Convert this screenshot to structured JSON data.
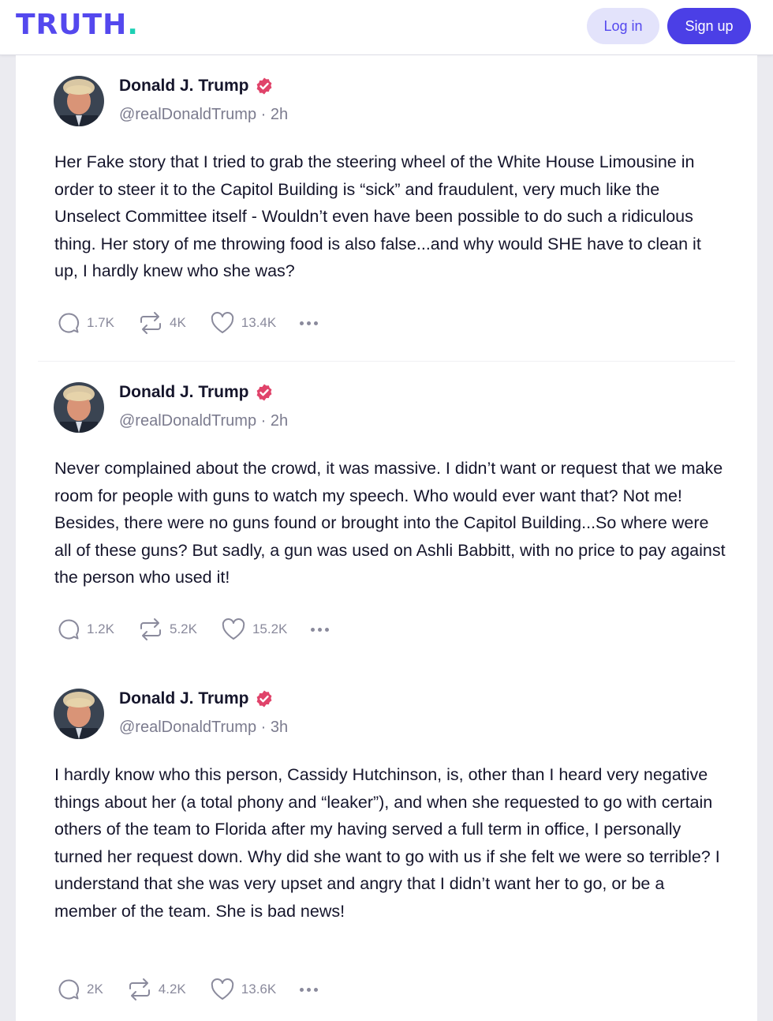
{
  "header": {
    "logo_text": "TRUTH",
    "logo_dot": ".",
    "login_label": "Log in",
    "signup_label": "Sign up"
  },
  "colors": {
    "brand": "#5448ee",
    "brand_accent": "#1dd0b4",
    "verified_badge": "#e0436a",
    "text_muted": "#7b7b8e"
  },
  "posts": [
    {
      "author": "Donald J. Trump",
      "handle": "@realDonaldTrump",
      "time": "2h",
      "text": "Her Fake story that I tried to  grab the steering wheel of the White House Limousine in order to steer it to the Capitol Building is “sick” and fraudulent, very much like the Unselect Committee itself - Wouldn’t even have been possible to do such a ridiculous thing. Her story of me throwing food is also false...and why would SHE have to clean it up, I hardly knew who she was?",
      "replies": "1.7K",
      "retruths": "4K",
      "likes": "13.4K"
    },
    {
      "author": "Donald J. Trump",
      "handle": "@realDonaldTrump",
      "time": "2h",
      "text": "Never complained about the crowd, it was massive. I didn’t want or request that we make room for people with guns to watch my speech. Who would ever want that? Not me! Besides, there were no guns found or brought into the Capitol Building...So where were all of these guns? But sadly, a gun was used on Ashli Babbitt, with no price to pay against the person who used it!",
      "replies": "1.2K",
      "retruths": "5.2K",
      "likes": "15.2K"
    },
    {
      "author": "Donald J. Trump",
      "handle": "@realDonaldTrump",
      "time": "3h",
      "text": "I hardly know who this person, Cassidy Hutchinson, is, other than I heard very negative things about her (a total phony and “leaker”), and when she requested to go with certain others of the team to Florida after my having served a full term in office, I personally turned her request down. Why did she want to go with us if she felt we were so terrible? I understand that she was very upset and angry that I didn’t want her to go, or be a member of the team. She is bad news!",
      "replies": "2K",
      "retruths": "4.2K",
      "likes": "13.6K"
    }
  ]
}
